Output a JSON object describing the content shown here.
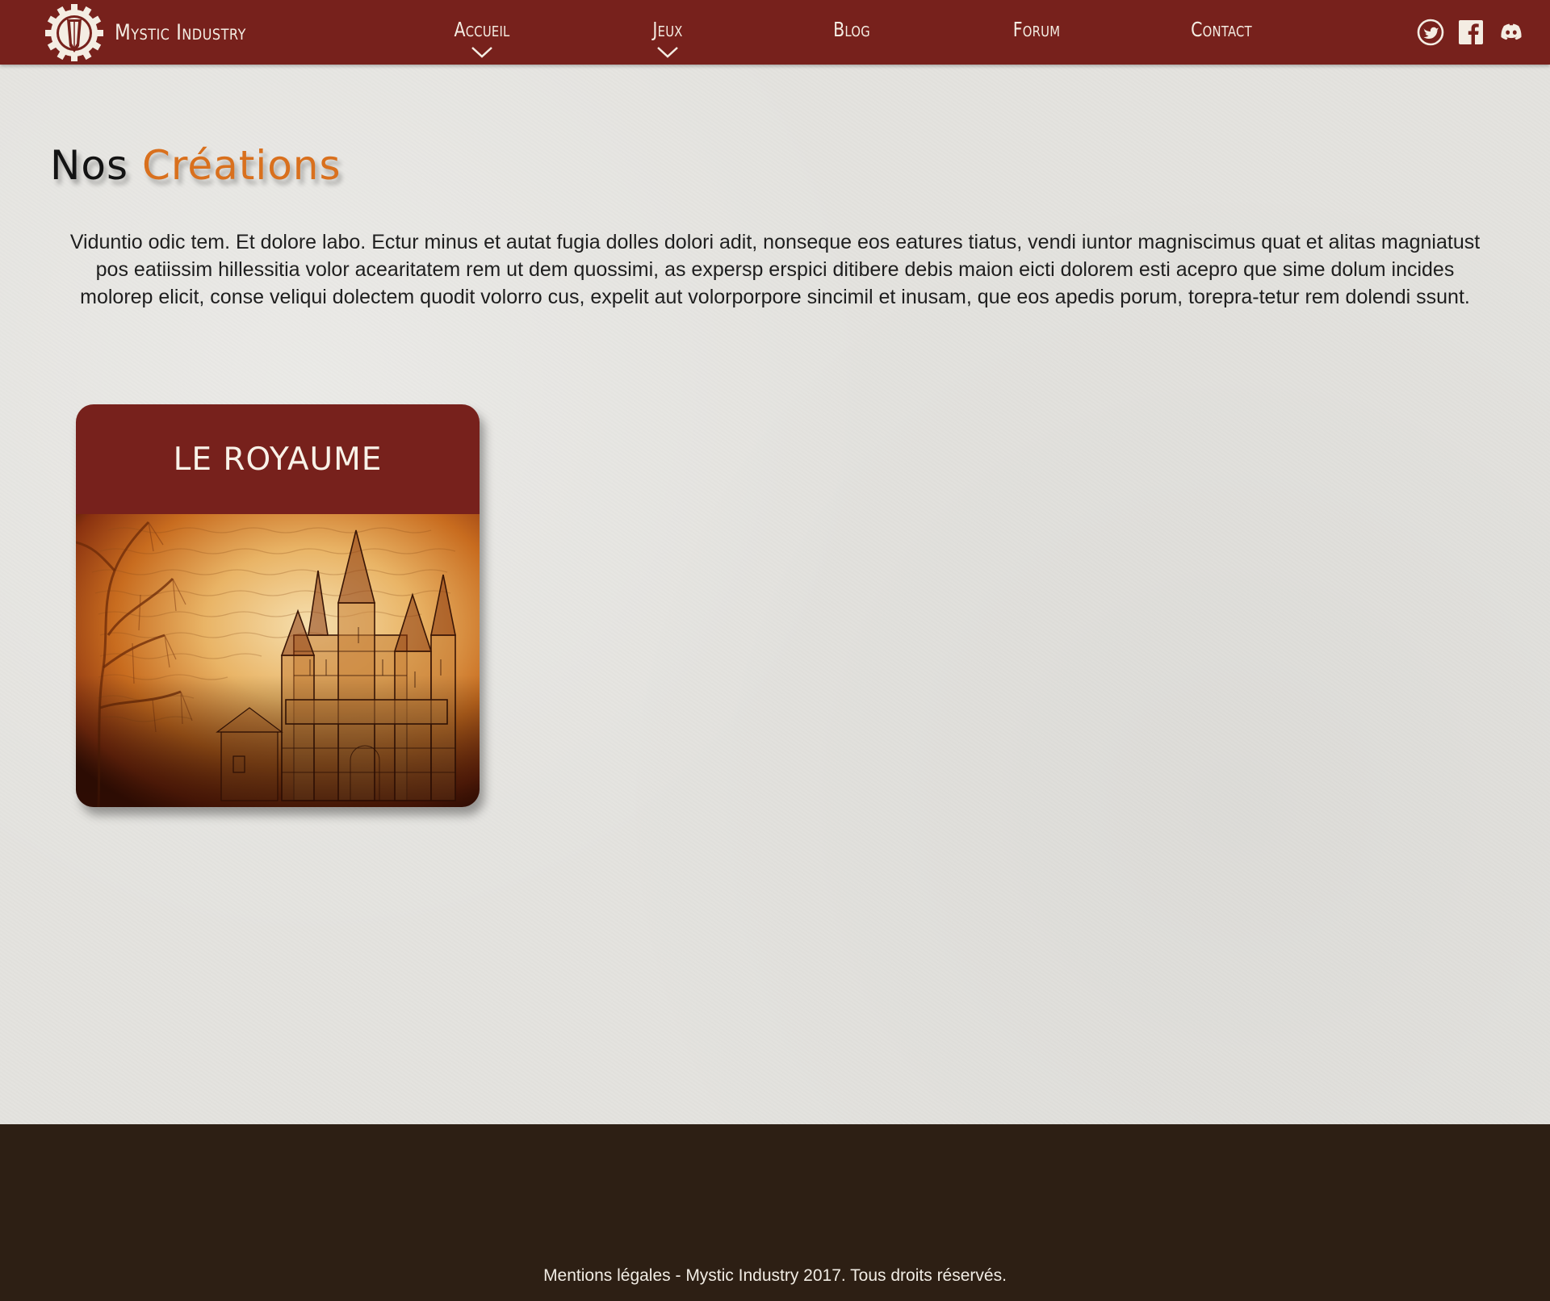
{
  "colors": {
    "brand": "#77211c",
    "accent": "#d9701d",
    "background": "#e3e2de",
    "footer": "#2d1f14"
  },
  "brand": {
    "name": "Mystic Industry",
    "logo_icon": "crystal-cog-logo"
  },
  "nav": {
    "items": [
      {
        "label": "Accueil",
        "has_dropdown": true
      },
      {
        "label": "Jeux",
        "has_dropdown": true
      },
      {
        "label": "Blog",
        "has_dropdown": false
      },
      {
        "label": "Forum",
        "has_dropdown": false
      },
      {
        "label": "Contact",
        "has_dropdown": false
      }
    ],
    "socials": [
      {
        "icon": "twitter-icon"
      },
      {
        "icon": "facebook-icon"
      },
      {
        "icon": "discord-icon"
      }
    ]
  },
  "main": {
    "title_prefix": "Nos",
    "title_accent": "Créations",
    "intro": "Viduntio odic tem. Et dolore labo. Ectur minus et autat fugia dolles dolori adit, nonseque eos eatures tiatus, vendi iuntor magniscimus quat et alitas magniatust pos eatiissim hillessitia volor acearitatem rem ut dem quossimi, as expersp erspici ditibere debis maion eicti dolorem esti acepro que sime dolum incides molorep elicit, conse veliqui dolectem quodit volorro cus, expelit aut volorporpore sincimil et inusam, que eos apedis porum, torepra-tetur rem dolendi ssunt.",
    "cards": [
      {
        "title": "LE ROYAUME",
        "image": "castle-illustration"
      }
    ]
  },
  "footer": {
    "text": "Mentions légales - Mystic Industry 2017. Tous droits réservés."
  }
}
